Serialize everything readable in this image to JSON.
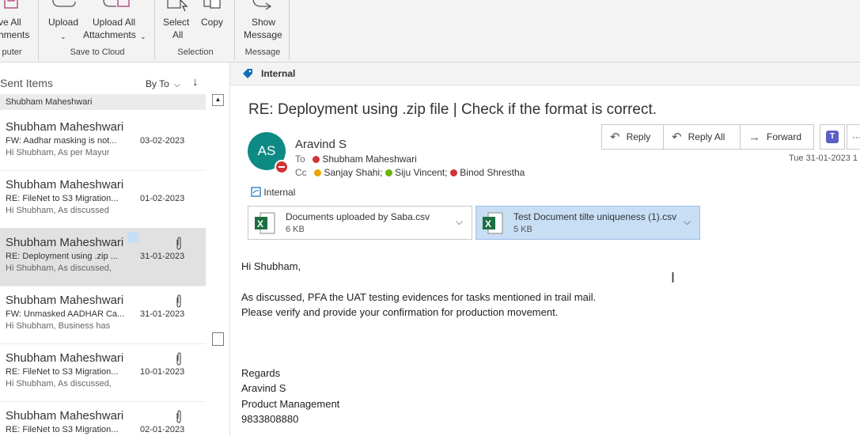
{
  "ribbon": {
    "save_all_line1": "ve All",
    "save_all_line2": "hments",
    "computer_group": "puter",
    "upload": "Upload",
    "upload_all_line1": "Upload All",
    "upload_all_line2": "Attachments",
    "save_cloud_group": "Save to Cloud",
    "select_all_line1": "Select",
    "select_all_line2": "All",
    "copy": "Copy",
    "selection_group": "Selection",
    "show_msg_line1": "Show",
    "show_msg_line2": "Message",
    "message_group": "Message"
  },
  "list": {
    "folder": "Sent Items",
    "sort": "By To",
    "group_header": "Shubham Maheshwari",
    "items": [
      {
        "from": "Shubham Maheshwari",
        "subject": "FW: Aadhar masking is not...",
        "preview": "Hi Shubham,  As per Mayur",
        "date": "03-02-2023",
        "attachment": false
      },
      {
        "from": "Shubham Maheshwari",
        "subject": "RE: FileNet to S3 Migration...",
        "preview": "Hi Shubham,  As discussed",
        "date": "01-02-2023",
        "attachment": false
      },
      {
        "from": "Shubham Maheshwari",
        "subject": "RE: Deployment using .zip ...",
        "preview": "Hi Shubham,  As discussed,",
        "date": "31-01-2023",
        "attachment": true
      },
      {
        "from": "Shubham Maheshwari",
        "subject": "FW: Unmasked AADHAR Ca...",
        "preview": "Hi Shubham,  Business has",
        "date": "31-01-2023",
        "attachment": true
      },
      {
        "from": "Shubham Maheshwari",
        "subject": "RE: FileNet to S3 Migration...",
        "preview": "Hi Shubham,  As discussed,",
        "date": "10-01-2023",
        "attachment": true
      },
      {
        "from": "Shubham Maheshwari",
        "subject": "RE: FileNet to S3 Migration...",
        "preview": "",
        "date": "02-01-2023",
        "attachment": true
      }
    ]
  },
  "message": {
    "sensitivity": "Internal",
    "subject": "RE: Deployment using .zip file | Check if the format is correct.",
    "avatar_initials": "AS",
    "sender": "Aravind S",
    "to_label": "To",
    "to": "Shubham Maheshwari",
    "cc_label": "Cc",
    "cc": [
      "Sanjay Shahi;",
      "Siju Vincent;",
      "Binod Shrestha"
    ],
    "date": "Tue 31-01-2023 1",
    "label": "Internal",
    "reply": "Reply",
    "reply_all": "Reply All",
    "forward": "Forward",
    "attachments": [
      {
        "name": "Documents uploaded by Saba.csv",
        "size": "6 KB"
      },
      {
        "name": "Test Document  tilte uniqueness (1).csv",
        "size": "5 KB"
      }
    ],
    "body": {
      "greeting": "Hi Shubham,",
      "line1": "As discussed, PFA the UAT testing evidences for tasks mentioned in trail mail.",
      "line2": "Please verify and provide your confirmation for production movement.",
      "sign1": "Regards",
      "sign2": "Aravind S",
      "sign3": "Product Management",
      "sign4": "9833808880"
    }
  },
  "colors": {
    "accent": "#0f6cbd",
    "avatar": "#0e8a84",
    "attachment_selected": "#c7def5",
    "excel": "#1d6f42"
  }
}
